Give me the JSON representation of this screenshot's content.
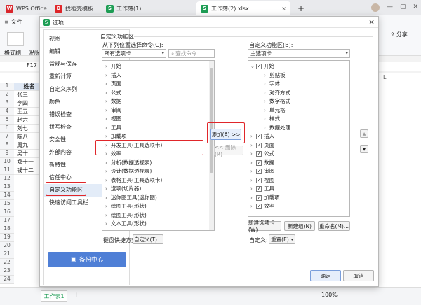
{
  "titlebar": {
    "tabs": [
      {
        "label": "WPS Office",
        "icon": "wps-logo-icon"
      },
      {
        "label": "找稻壳模板",
        "icon": "docer-icon"
      },
      {
        "label": "工作簿(1)",
        "icon": "sheet-icon"
      },
      {
        "label": "工作簿(2).xlsx",
        "icon": "sheet-icon"
      }
    ],
    "plus": "+"
  },
  "ribbon": {
    "file_label": "文件",
    "format_painter": "格式刷",
    "paste": "粘贴",
    "share": "分享"
  },
  "formula": {
    "cell_ref": "F17"
  },
  "sheet": {
    "rows": [
      "1",
      "2",
      "3",
      "4",
      "5",
      "6",
      "7",
      "8",
      "9",
      "10",
      "11",
      "12",
      "13",
      "14",
      "15",
      "16",
      "17",
      "18",
      "19",
      "20",
      "21",
      "22",
      "23",
      "24"
    ],
    "colA": [
      "姓名",
      "张三",
      "李四",
      "王五",
      "赵六",
      "刘七",
      "陈八",
      "周九",
      "吴十",
      "郑十一",
      "钱十二"
    ],
    "col_letter_l": "L",
    "sheet_tab": "工作表1",
    "add_sheet": "+",
    "zoom": "100%"
  },
  "dialog": {
    "title": "选项",
    "close": "×",
    "nav": [
      "视图",
      "编辑",
      "常规与保存",
      "重新计算",
      "自定义序列",
      "颜色",
      "错误检查",
      "拼写检查",
      "安全性",
      "外部内容",
      "新特性",
      "信任中心",
      "自定义功能区",
      "快速访问工具栏"
    ],
    "nav_selected": "自定义功能区",
    "backup_label": "备份中心",
    "section_title": "自定义功能区",
    "left_label": "从下列位置选择命令(C):",
    "left_combo": "所有选项卡",
    "search_placeholder": "查找命令",
    "left_items": [
      "开始",
      "插入",
      "页面",
      "公式",
      "数据",
      "审阅",
      "视图",
      "工具",
      "加载项",
      "开发工具(工具选项卡)",
      "效率",
      "分析(数据透视表)",
      "设计(数据透视表)",
      "表格工具(工具选项卡)",
      "选项(切片器)",
      "迷你图工具(迷你图)",
      "绘图工具(形状)",
      "绘图工具(形状)",
      "文本工具(形状)"
    ],
    "add_btn": "添加(A) >>",
    "remove_btn": "<< 删除(R)",
    "right_label": "自定义功能区(B):",
    "right_combo": "主选项卡",
    "right_items": [
      {
        "label": "开始",
        "level": 0,
        "checked": true,
        "expanded": true
      },
      {
        "label": "剪贴板",
        "level": 1
      },
      {
        "label": "字体",
        "level": 1
      },
      {
        "label": "对齐方式",
        "level": 1
      },
      {
        "label": "数字格式",
        "level": 1
      },
      {
        "label": "单元格",
        "level": 1
      },
      {
        "label": "样式",
        "level": 1
      },
      {
        "label": "数据处理",
        "level": 1
      },
      {
        "label": "插入",
        "level": 0,
        "checked": true
      },
      {
        "label": "页面",
        "level": 0,
        "checked": true
      },
      {
        "label": "公式",
        "level": 0,
        "checked": true
      },
      {
        "label": "数据",
        "level": 0,
        "checked": true
      },
      {
        "label": "审阅",
        "level": 0,
        "checked": true
      },
      {
        "label": "视图",
        "level": 0,
        "checked": true
      },
      {
        "label": "工具",
        "level": 0,
        "checked": true
      },
      {
        "label": "加载项",
        "level": 0,
        "checked": true
      },
      {
        "label": "效率",
        "level": 0,
        "checked": true
      }
    ],
    "new_tab_btn": "新建选项卡(W)",
    "new_group_btn": "新建组(N)",
    "rename_btn": "重命名(M)...",
    "keyboard_label": "键盘快捷方式:",
    "keyboard_btn": "自定义(T)...",
    "customize_label": "自定义:",
    "reset_btn": "重置(E)",
    "ok_btn": "确定",
    "cancel_btn": "取消"
  },
  "colors": {
    "accent": "#4f7fd6",
    "highlight": "#e0262a",
    "wps_red": "#d9262c",
    "sheet_green": "#1e9e55"
  }
}
